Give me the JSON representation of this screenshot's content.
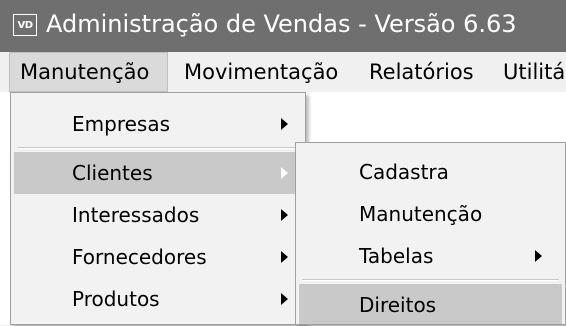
{
  "window": {
    "icon_text": "VD",
    "title": "Administração de Vendas - Versão 6.63"
  },
  "menubar": {
    "items": [
      {
        "label": "Manutenção"
      },
      {
        "label": "Movimentação"
      },
      {
        "label": "Relatórios"
      },
      {
        "label": "Utilitá"
      }
    ]
  },
  "manutencao_menu": {
    "items": [
      {
        "label": "Empresas",
        "has_submenu": true
      },
      {
        "label": "Clientes",
        "has_submenu": true,
        "highlighted": true
      },
      {
        "label": "Interessados",
        "has_submenu": true
      },
      {
        "label": "Fornecedores",
        "has_submenu": true
      },
      {
        "label": "Produtos",
        "has_submenu": true
      }
    ]
  },
  "clientes_submenu": {
    "items": [
      {
        "label": "Cadastra",
        "has_submenu": false
      },
      {
        "label": "Manutenção",
        "has_submenu": false
      },
      {
        "label": "Tabelas",
        "has_submenu": true
      },
      {
        "label": "Direitos",
        "has_submenu": false,
        "highlighted": true
      }
    ]
  }
}
